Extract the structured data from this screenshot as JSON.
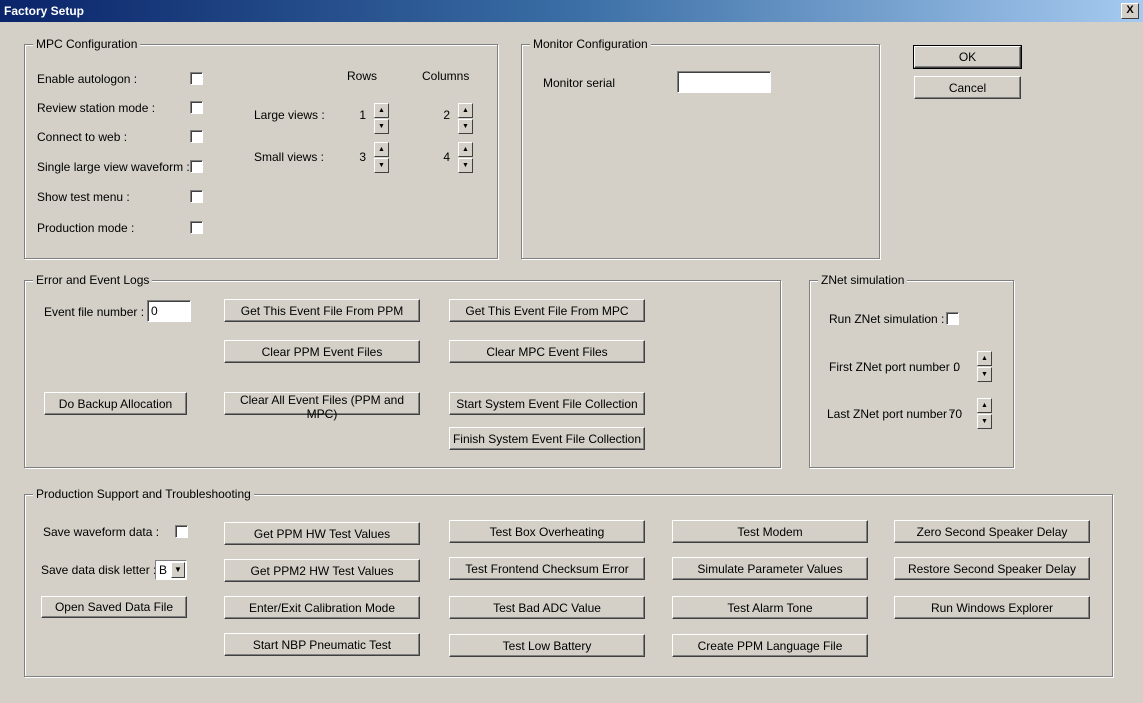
{
  "window": {
    "title": "Factory Setup",
    "close_glyph": "X"
  },
  "mpc": {
    "legend": "MPC Configuration",
    "options": [
      "Enable autologon :",
      "Review station mode :",
      "Connect to web :",
      "Single large view waveform :",
      "Show test menu :",
      "Production mode :"
    ],
    "rows_label": "Rows",
    "columns_label": "Columns",
    "large_views_label": "Large views :",
    "small_views_label": "Small views :",
    "large_rows": "1",
    "large_cols": "2",
    "small_rows": "3",
    "small_cols": "4"
  },
  "monitor": {
    "legend": "Monitor Configuration",
    "serial_label": "Monitor serial",
    "serial_value": ""
  },
  "dialog": {
    "ok": "OK",
    "cancel": "Cancel"
  },
  "logs": {
    "legend": "Error and Event Logs",
    "event_file_label": "Event file number :",
    "event_file_value": "0",
    "get_ppm": "Get This Event File From PPM",
    "get_mpc": "Get This Event File From MPC",
    "clear_ppm": "Clear PPM Event Files",
    "clear_mpc": "Clear MPC Event Files",
    "backup": "Do Backup Allocation",
    "clear_all": "Clear All Event Files (PPM and MPC)",
    "start_collection": "Start System Event File Collection",
    "finish_collection": "Finish System Event File Collection"
  },
  "znet": {
    "legend": "ZNet simulation",
    "run_label": "Run ZNet simulation :",
    "first_label": "First ZNet port number :",
    "first_value": "0",
    "last_label": "Last ZNet port number :",
    "last_value": "70"
  },
  "prod": {
    "legend": "Production Support and Troubleshooting",
    "save_waveform_label": "Save waveform data :",
    "disk_letter_label": "Save data disk letter :",
    "disk_letter_value": "B",
    "open_saved": "Open Saved Data File",
    "col2": [
      "Get PPM HW Test Values",
      "Get PPM2 HW Test Values",
      "Enter/Exit Calibration Mode",
      "Start NBP Pneumatic Test"
    ],
    "col3": [
      "Test Box Overheating",
      "Test Frontend Checksum Error",
      "Test Bad ADC Value",
      "Test Low Battery"
    ],
    "col4": [
      "Test Modem",
      "Simulate Parameter Values",
      "Test Alarm Tone",
      "Create PPM Language File"
    ],
    "col5": [
      "Zero Second Speaker Delay",
      "Restore Second Speaker Delay",
      "Run Windows Explorer"
    ]
  }
}
